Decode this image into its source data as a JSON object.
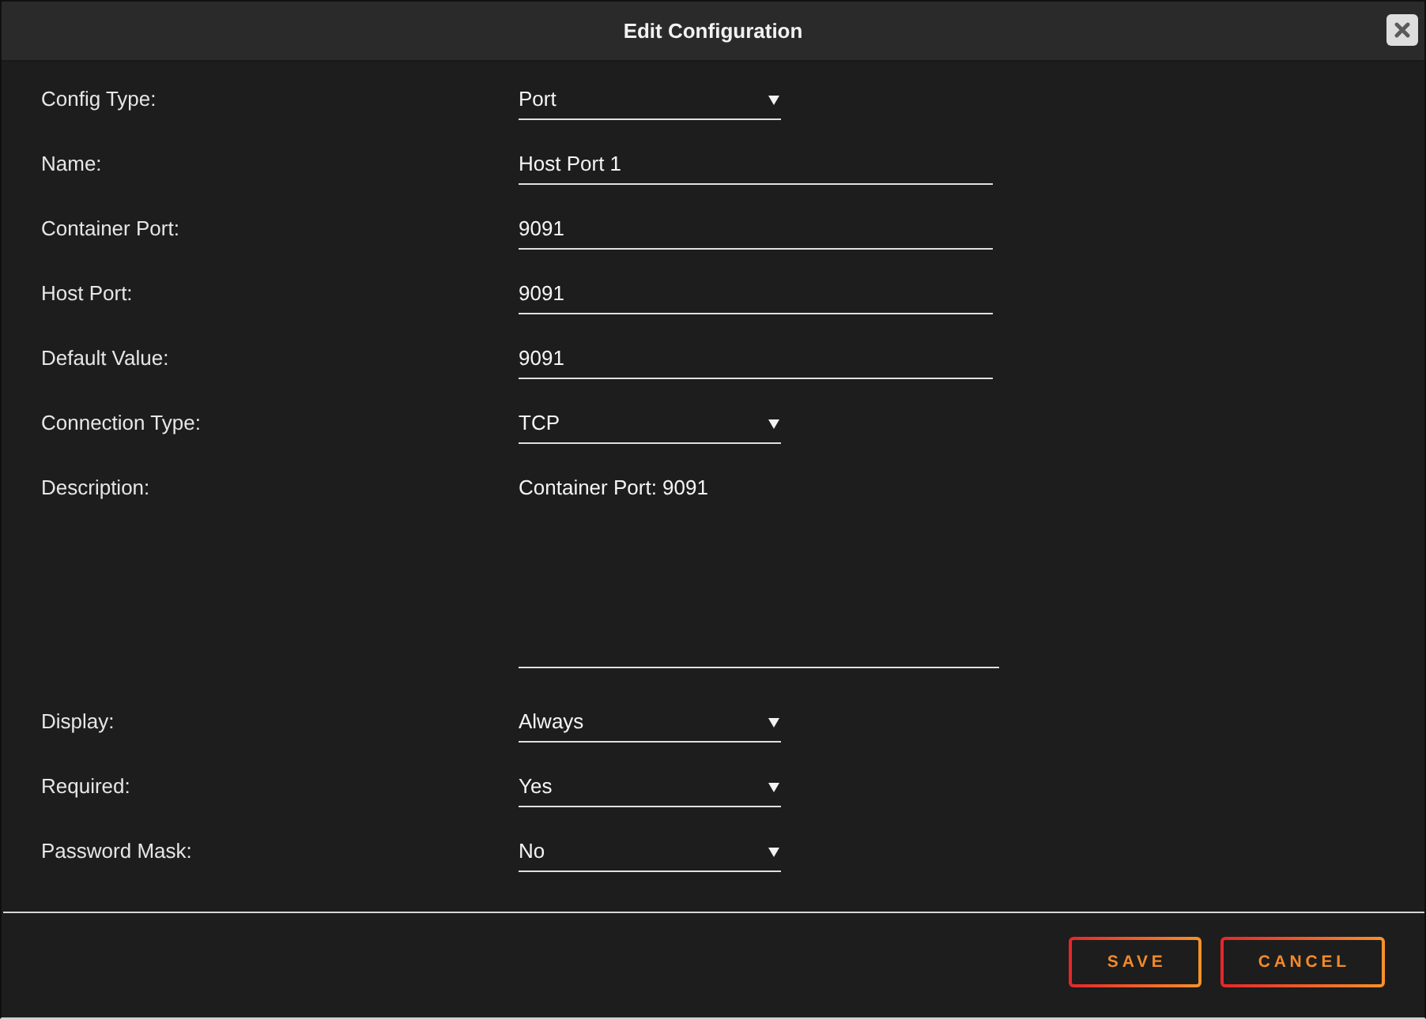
{
  "dialog": {
    "title": "Edit Configuration"
  },
  "fields": [
    {
      "label": "Config Type:",
      "kind": "select",
      "value": "Port"
    },
    {
      "label": "Name:",
      "kind": "text",
      "value": "Host Port 1"
    },
    {
      "label": "Container Port:",
      "kind": "text",
      "value": "9091"
    },
    {
      "label": "Host Port:",
      "kind": "text",
      "value": "9091"
    },
    {
      "label": "Default Value:",
      "kind": "text",
      "value": "9091"
    },
    {
      "label": "Connection Type:",
      "kind": "select",
      "value": "TCP"
    },
    {
      "label": "Description:",
      "kind": "textarea",
      "value": "Container Port: 9091"
    },
    {
      "label": "Display:",
      "kind": "select",
      "value": "Always"
    },
    {
      "label": "Required:",
      "kind": "select",
      "value": "Yes"
    },
    {
      "label": "Password Mask:",
      "kind": "select",
      "value": "No"
    }
  ],
  "buttons": [
    {
      "label": "SAVE"
    },
    {
      "label": "CANCEL"
    }
  ]
}
